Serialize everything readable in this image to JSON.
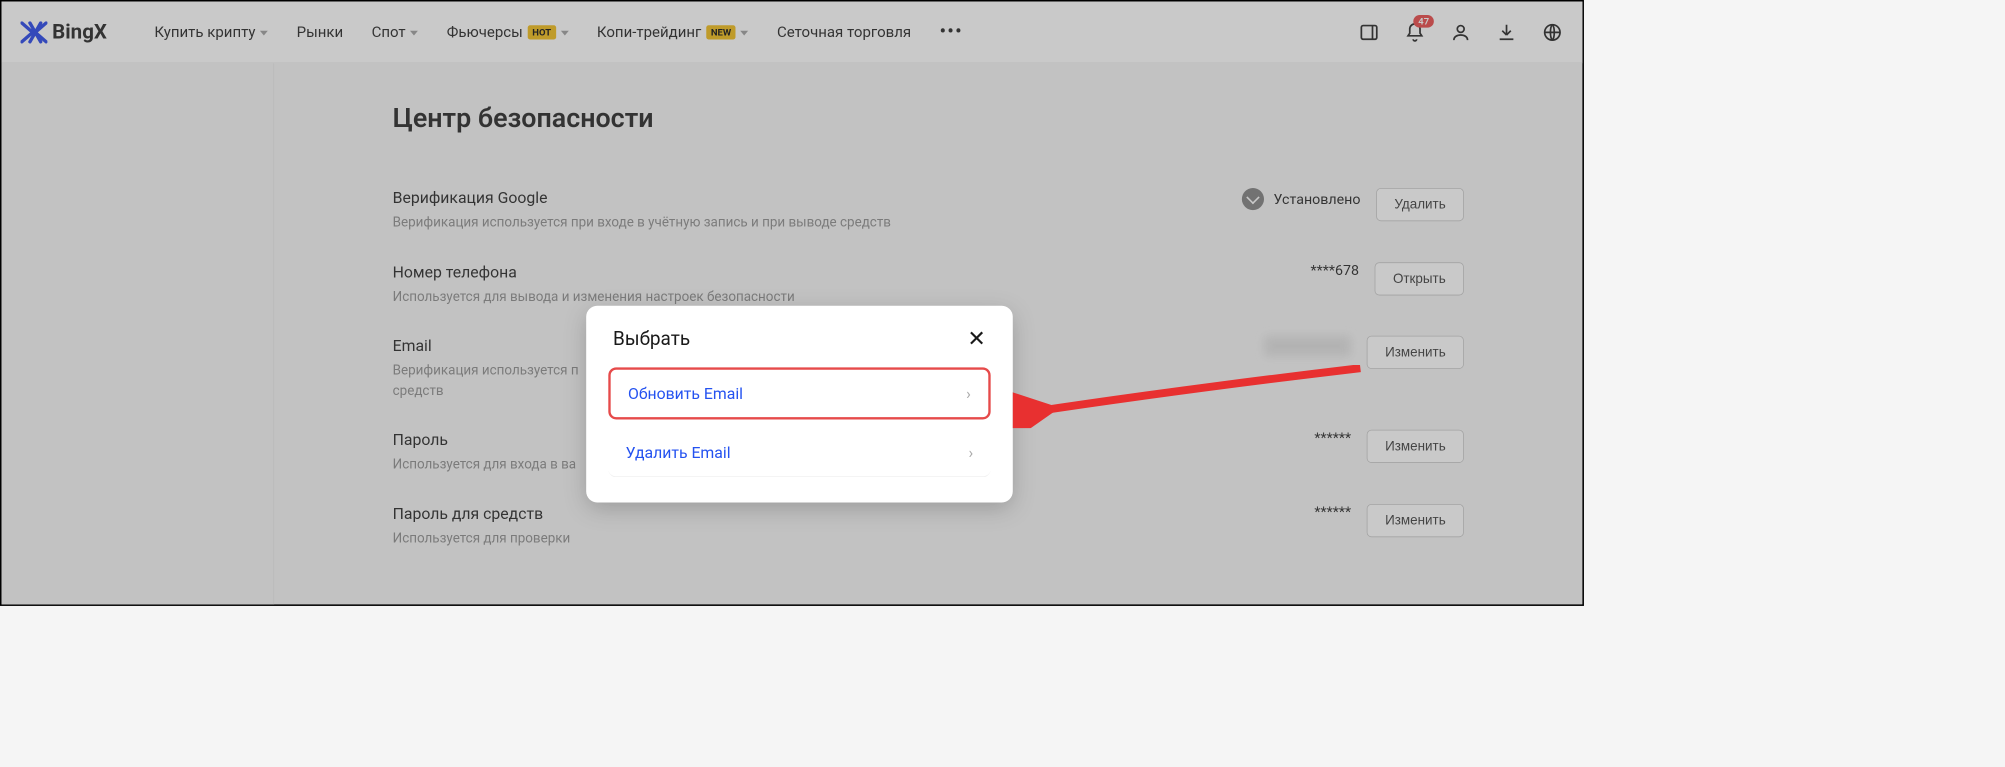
{
  "brand": "BingX",
  "nav": {
    "buy": "Купить крипту",
    "markets": "Рынки",
    "spot": "Спот",
    "futures": "Фьючерсы",
    "futures_badge": "HOT",
    "copy": "Копи-трейдинг",
    "copy_badge": "NEW",
    "grid": "Сеточная торговля"
  },
  "notif_count": "47",
  "page_title": "Центр безопасности",
  "rows": {
    "google": {
      "title": "Верификация Google",
      "desc": "Верификация используется при входе в учётную запись и при выводе средств",
      "status": "Установлено",
      "action": "Удалить"
    },
    "phone": {
      "title": "Номер телефона",
      "desc": "Используется для вывода и изменения настроек безопасности",
      "value": "****678",
      "action": "Открыть"
    },
    "email": {
      "title": "Email",
      "desc": "Верификация используется п",
      "desc2": "средств",
      "action": "Изменить"
    },
    "password": {
      "title": "Пароль",
      "desc": "Используется для входа в ва",
      "value": "******",
      "action": "Изменить"
    },
    "funds_password": {
      "title": "Пароль для средств",
      "desc": "Используется для проверки",
      "value": "******",
      "action": "Изменить"
    }
  },
  "modal": {
    "title": "Выбрать",
    "opt1": "Обновить Email",
    "opt2": "Удалить Email"
  }
}
